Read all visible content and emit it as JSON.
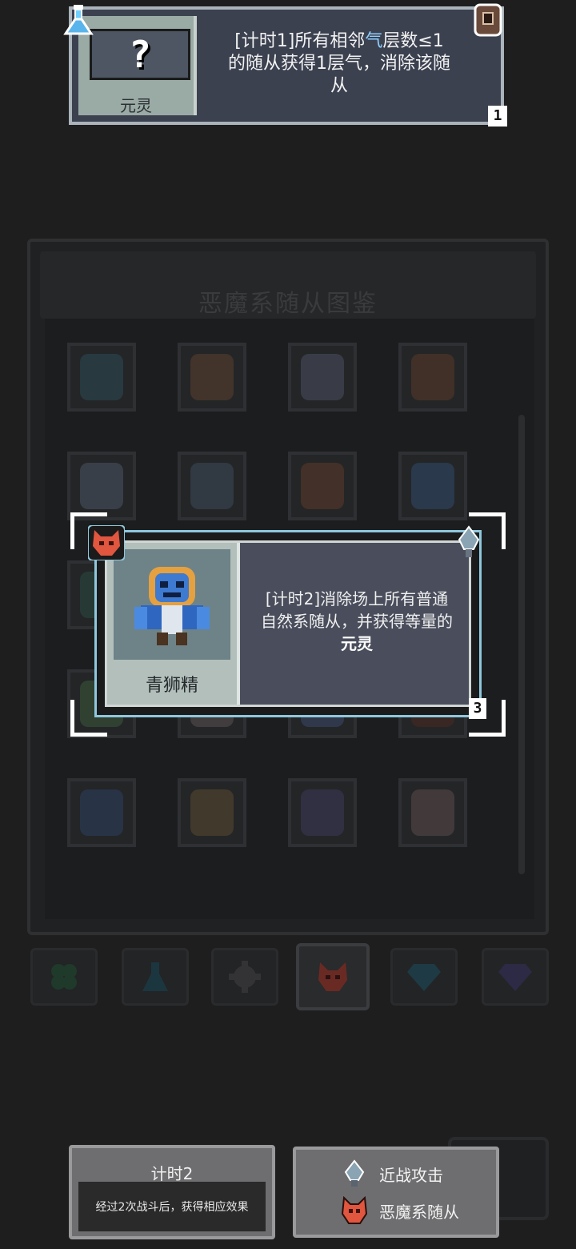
{
  "top_card": {
    "portrait_label": "元灵",
    "question_mark": "?",
    "desc_part1": "[计时1]所有相邻",
    "desc_highlight": "气",
    "desc_part2": "层数≤1",
    "desc_line2": "的随从获得1层气，消除该随",
    "desc_line3": "从",
    "count": "1",
    "icons": {
      "left": "flask-icon",
      "right": "lock-icon"
    }
  },
  "gallery": {
    "title": "恶魔系随从图鉴",
    "sprite_colors": [
      [
        "#2c4a55",
        "#5b4030",
        "#4b5060",
        "#5a3a28"
      ],
      [
        "#4a5566",
        "#3d4a5a",
        "#5c3a2a",
        "#2f4a6a"
      ],
      [
        "#2a4a40",
        "#4a3a3a",
        "#5a3a2a",
        "#4a3020"
      ],
      [
        "#3a5a3a",
        "#5a5050",
        "#3a4a6a",
        "#4a2a22"
      ],
      [
        "#2c4060",
        "#5a4a30",
        "#3a3a5a",
        "#5a4a4a"
      ]
    ]
  },
  "tabs": [
    {
      "name": "clover-tab-icon",
      "color": "#1f3a2a"
    },
    {
      "name": "flask-tab-icon",
      "color": "#1c3640"
    },
    {
      "name": "gear-tab-icon",
      "color": "#3a3a3c"
    },
    {
      "name": "demon-tab-icon",
      "color": "#6a2a24",
      "active": true
    },
    {
      "name": "gem-tab-icon",
      "color": "#1e3a44"
    },
    {
      "name": "diamond-tab-icon",
      "color": "#2c2a44"
    }
  ],
  "selected_card": {
    "name": "青狮精",
    "desc_line1": "[计时2]消除场上所有普通",
    "desc_line2": "自然系随从，并获得等量的",
    "desc_keyword": "元灵",
    "level": "3",
    "colors": {
      "accent": "#8fc7dd",
      "demon": "#e0563f"
    }
  },
  "timer_info": {
    "title": "计时2",
    "description": "经过2次战斗后，获得相应效果"
  },
  "tags": [
    {
      "icon": "sword-icon",
      "label": "近战攻击"
    },
    {
      "icon": "demon-mask-icon",
      "label": "恶魔系随从"
    }
  ]
}
